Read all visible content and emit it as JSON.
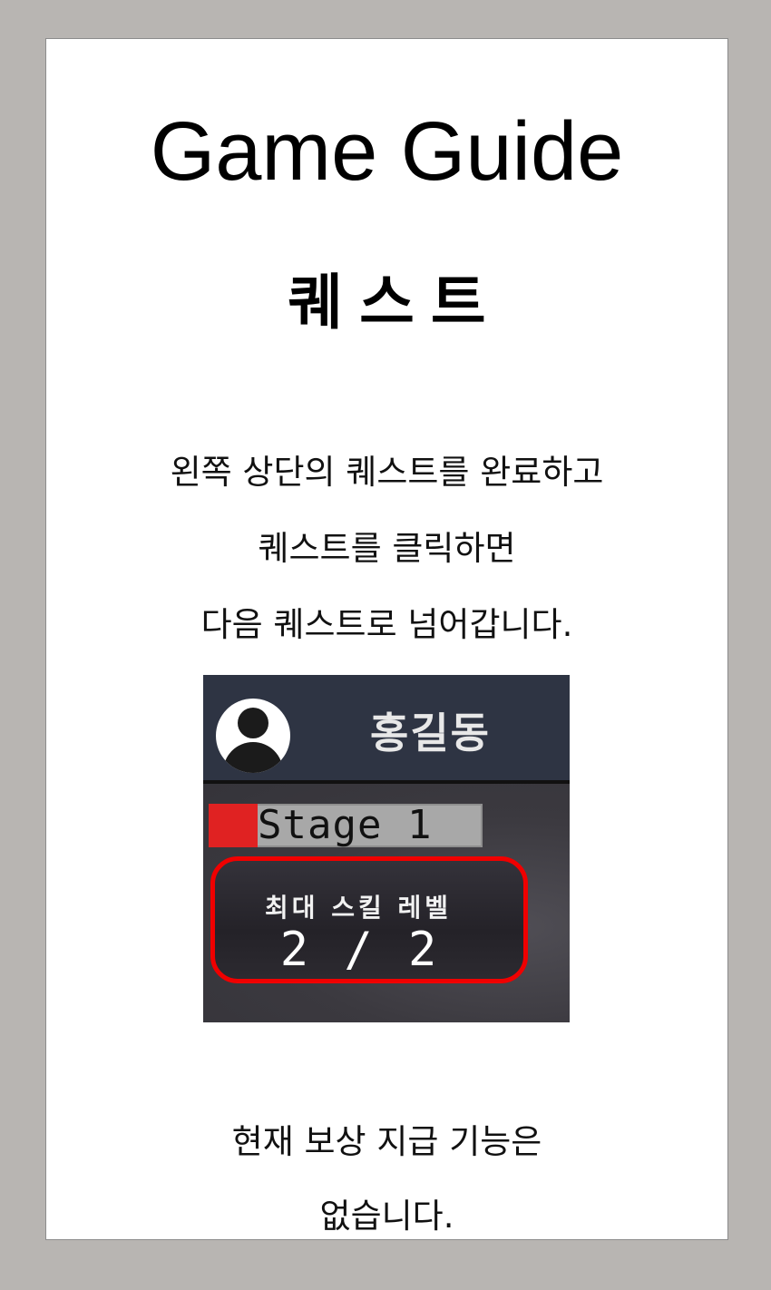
{
  "page": {
    "title": "Game Guide",
    "subtitle": "퀘스트",
    "description_lines": [
      "왼쪽 상단의 퀘스트를 완료하고",
      "퀘스트를 클릭하면",
      "다음 퀘스트로 넘어갑니다."
    ],
    "note_lines": [
      "현재 보상 지급 기능은",
      "없습니다."
    ]
  },
  "screenshot": {
    "player_name": "홍길동",
    "avatar_icon": "user-avatar-icon",
    "stage_label": "Stage 1",
    "stage_progress": 0.18,
    "skill_label": "최대 스킬 레벨",
    "skill_value": "2 / 2",
    "highlight_color": "#f00000",
    "progress_color": "#e02222"
  }
}
